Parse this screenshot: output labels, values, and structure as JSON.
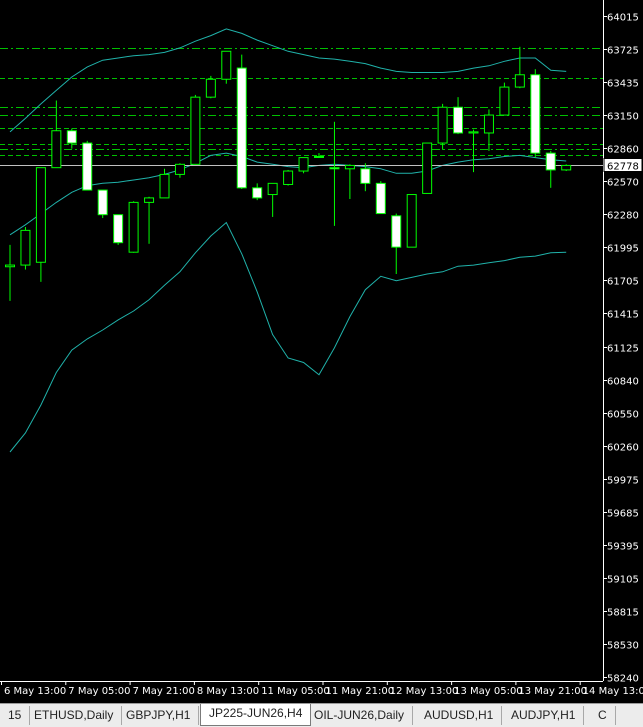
{
  "window": {
    "title": "JP225-JUN26,H4"
  },
  "tabs": [
    {
      "label": "15",
      "active": false
    },
    {
      "label": "ETHUSD,Daily",
      "active": false
    },
    {
      "label": "GBPJPY,H1",
      "active": false
    },
    {
      "label": "JP225-JUN26,H4",
      "active": true
    },
    {
      "label": "OIL-JUN26,Daily",
      "active": false
    },
    {
      "label": "AUDUSD,H1",
      "active": false
    },
    {
      "label": "AUDJPY,H1",
      "active": false
    },
    {
      "label": "C",
      "active": false
    }
  ],
  "colors": {
    "background": "#000000",
    "candle": "#00ff00",
    "bull_body": "#000000",
    "bear_body": "#ffffff",
    "bollinger": "#20b2aa",
    "levels": "#00c000",
    "price_line": "#c0c0c0",
    "axis_text": "#ffffff"
  },
  "chart_data": {
    "type": "candlestick",
    "symbol": "JP225-JUN26",
    "timeframe": "H4",
    "current_price": "62778",
    "y_ticks": [
      "64015",
      "63725",
      "63435",
      "63150",
      "62860",
      "62570",
      "62280",
      "61995",
      "61705",
      "61415",
      "61125",
      "60840",
      "60550",
      "60260",
      "59975",
      "59685",
      "59395",
      "59105",
      "58815",
      "58530",
      "58240"
    ],
    "x_ticks": [
      "6 May 13:00",
      "7 May 05:00",
      "7 May 21:00",
      "8 May 13:00",
      "11 May 05:00",
      "11 May 21:00",
      "12 May 13:00",
      "13 May 05:00",
      "13 May 21:00",
      "14 May 13:00"
    ],
    "ylim": [
      58200,
      64105
    ],
    "candles": [
      {
        "o": 61865,
        "h": 62060,
        "l": 61560,
        "c": 61880
      },
      {
        "o": 61880,
        "h": 62220,
        "l": 61840,
        "c": 62190
      },
      {
        "o": 61905,
        "h": 62750,
        "l": 61730,
        "c": 62750
      },
      {
        "o": 62750,
        "h": 63350,
        "l": 62750,
        "c": 63080
      },
      {
        "o": 63080,
        "h": 63100,
        "l": 62920,
        "c": 62970
      },
      {
        "o": 62970,
        "h": 62990,
        "l": 62550,
        "c": 62550
      },
      {
        "o": 62550,
        "h": 62550,
        "l": 62300,
        "c": 62330
      },
      {
        "o": 62330,
        "h": 62330,
        "l": 62060,
        "c": 62080
      },
      {
        "o": 61995,
        "h": 62450,
        "l": 61990,
        "c": 62440
      },
      {
        "o": 62440,
        "h": 62490,
        "l": 62070,
        "c": 62480
      },
      {
        "o": 62480,
        "h": 62740,
        "l": 62480,
        "c": 62690
      },
      {
        "o": 62690,
        "h": 62790,
        "l": 62660,
        "c": 62780
      },
      {
        "o": 62780,
        "h": 63400,
        "l": 62780,
        "c": 63380
      },
      {
        "o": 63380,
        "h": 63570,
        "l": 63370,
        "c": 63540
      },
      {
        "o": 63540,
        "h": 63790,
        "l": 63500,
        "c": 63790
      },
      {
        "o": 63640,
        "h": 63760,
        "l": 62560,
        "c": 62570
      },
      {
        "o": 62570,
        "h": 62610,
        "l": 62460,
        "c": 62480
      },
      {
        "o": 62510,
        "h": 62610,
        "l": 62310,
        "c": 62610
      },
      {
        "o": 62600,
        "h": 62730,
        "l": 62590,
        "c": 62720
      },
      {
        "o": 62720,
        "h": 62840,
        "l": 62700,
        "c": 62840
      },
      {
        "o": 62850,
        "h": 62880,
        "l": 62840,
        "c": 62850
      },
      {
        "o": 62750,
        "h": 63160,
        "l": 62230,
        "c": 62740
      },
      {
        "o": 62740,
        "h": 62780,
        "l": 62470,
        "c": 62770
      },
      {
        "o": 62740,
        "h": 62790,
        "l": 62540,
        "c": 62610
      },
      {
        "o": 62610,
        "h": 62630,
        "l": 62350,
        "c": 62340
      },
      {
        "o": 62320,
        "h": 62340,
        "l": 61800,
        "c": 62040
      },
      {
        "o": 62040,
        "h": 62510,
        "l": 62040,
        "c": 62510
      },
      {
        "o": 62520,
        "h": 62970,
        "l": 62520,
        "c": 62970
      },
      {
        "o": 62970,
        "h": 63320,
        "l": 62910,
        "c": 63290
      },
      {
        "o": 63290,
        "h": 63380,
        "l": 63050,
        "c": 63060
      },
      {
        "o": 63060,
        "h": 63090,
        "l": 62710,
        "c": 63070
      },
      {
        "o": 63060,
        "h": 63270,
        "l": 62900,
        "c": 63220
      },
      {
        "o": 63220,
        "h": 63510,
        "l": 63220,
        "c": 63470
      },
      {
        "o": 63470,
        "h": 63830,
        "l": 63460,
        "c": 63580
      },
      {
        "o": 63580,
        "h": 63630,
        "l": 62840,
        "c": 62880
      },
      {
        "o": 62880,
        "h": 62900,
        "l": 62570,
        "c": 62730
      },
      {
        "o": 62730,
        "h": 62780,
        "l": 62720,
        "c": 62770
      }
    ],
    "bollinger_upper": [
      63070,
      63190,
      63320,
      63440,
      63560,
      63650,
      63710,
      63730,
      63750,
      63760,
      63780,
      63820,
      63880,
      63930,
      63990,
      63950,
      63890,
      63840,
      63790,
      63760,
      63730,
      63720,
      63700,
      63680,
      63640,
      63610,
      63600,
      63600,
      63600,
      63610,
      63640,
      63660,
      63700,
      63730,
      63730,
      63620,
      63610
    ],
    "bollinger_middle": [
      62150,
      62240,
      62340,
      62440,
      62530,
      62590,
      62610,
      62620,
      62640,
      62660,
      62690,
      62730,
      62790,
      62860,
      62880,
      62850,
      62800,
      62780,
      62760,
      62750,
      62770,
      62780,
      62770,
      62760,
      62740,
      62700,
      62700,
      62720,
      62770,
      62800,
      62820,
      62830,
      62850,
      62860,
      62840,
      62820,
      62810
    ],
    "bollinger_lower": [
      60210,
      60380,
      60630,
      60920,
      61120,
      61220,
      61300,
      61390,
      61470,
      61570,
      61700,
      61820,
      61990,
      62140,
      62260,
      61980,
      61640,
      61260,
      61050,
      61010,
      60900,
      61140,
      61420,
      61660,
      61780,
      61740,
      61770,
      61800,
      61820,
      61870,
      61880,
      61900,
      61920,
      61950,
      61960,
      61990,
      61995
    ],
    "levels": [
      {
        "price": 63820,
        "style": "dash-dot"
      },
      {
        "price": 63550,
        "style": "dash"
      },
      {
        "price": 63290,
        "style": "dash-dot"
      },
      {
        "price": 63220,
        "style": "dash-dot"
      },
      {
        "price": 63100,
        "style": "dash"
      },
      {
        "price": 62960,
        "style": "dash"
      },
      {
        "price": 62920,
        "style": "dash-dot"
      },
      {
        "price": 62860,
        "style": "dash"
      }
    ]
  }
}
